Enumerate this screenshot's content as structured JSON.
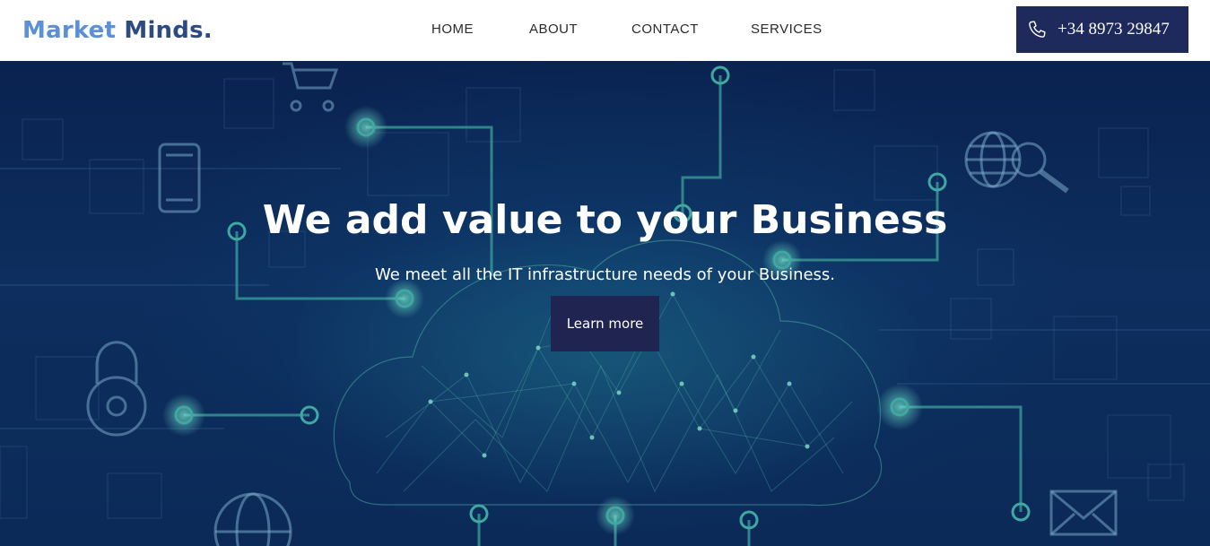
{
  "brand": {
    "word1": "Market",
    "word2": "Minds."
  },
  "nav": {
    "items": [
      {
        "label": "HOME"
      },
      {
        "label": "ABOUT"
      },
      {
        "label": "CONTACT"
      },
      {
        "label": "SERVICES"
      }
    ]
  },
  "contact": {
    "icon": "phone-icon",
    "phone": "+34 8973 29847"
  },
  "hero": {
    "title": "We add value to your Business",
    "subtitle": "We meet all the IT infrastructure needs of your Business.",
    "cta_label": "Learn more"
  },
  "colors": {
    "brand_light": "#5b8fd6",
    "brand_dark": "#2d4a82",
    "button_bg": "#1f2a5c",
    "hero_bg": "#0d2e5e",
    "circuit": "#3a9a96"
  }
}
